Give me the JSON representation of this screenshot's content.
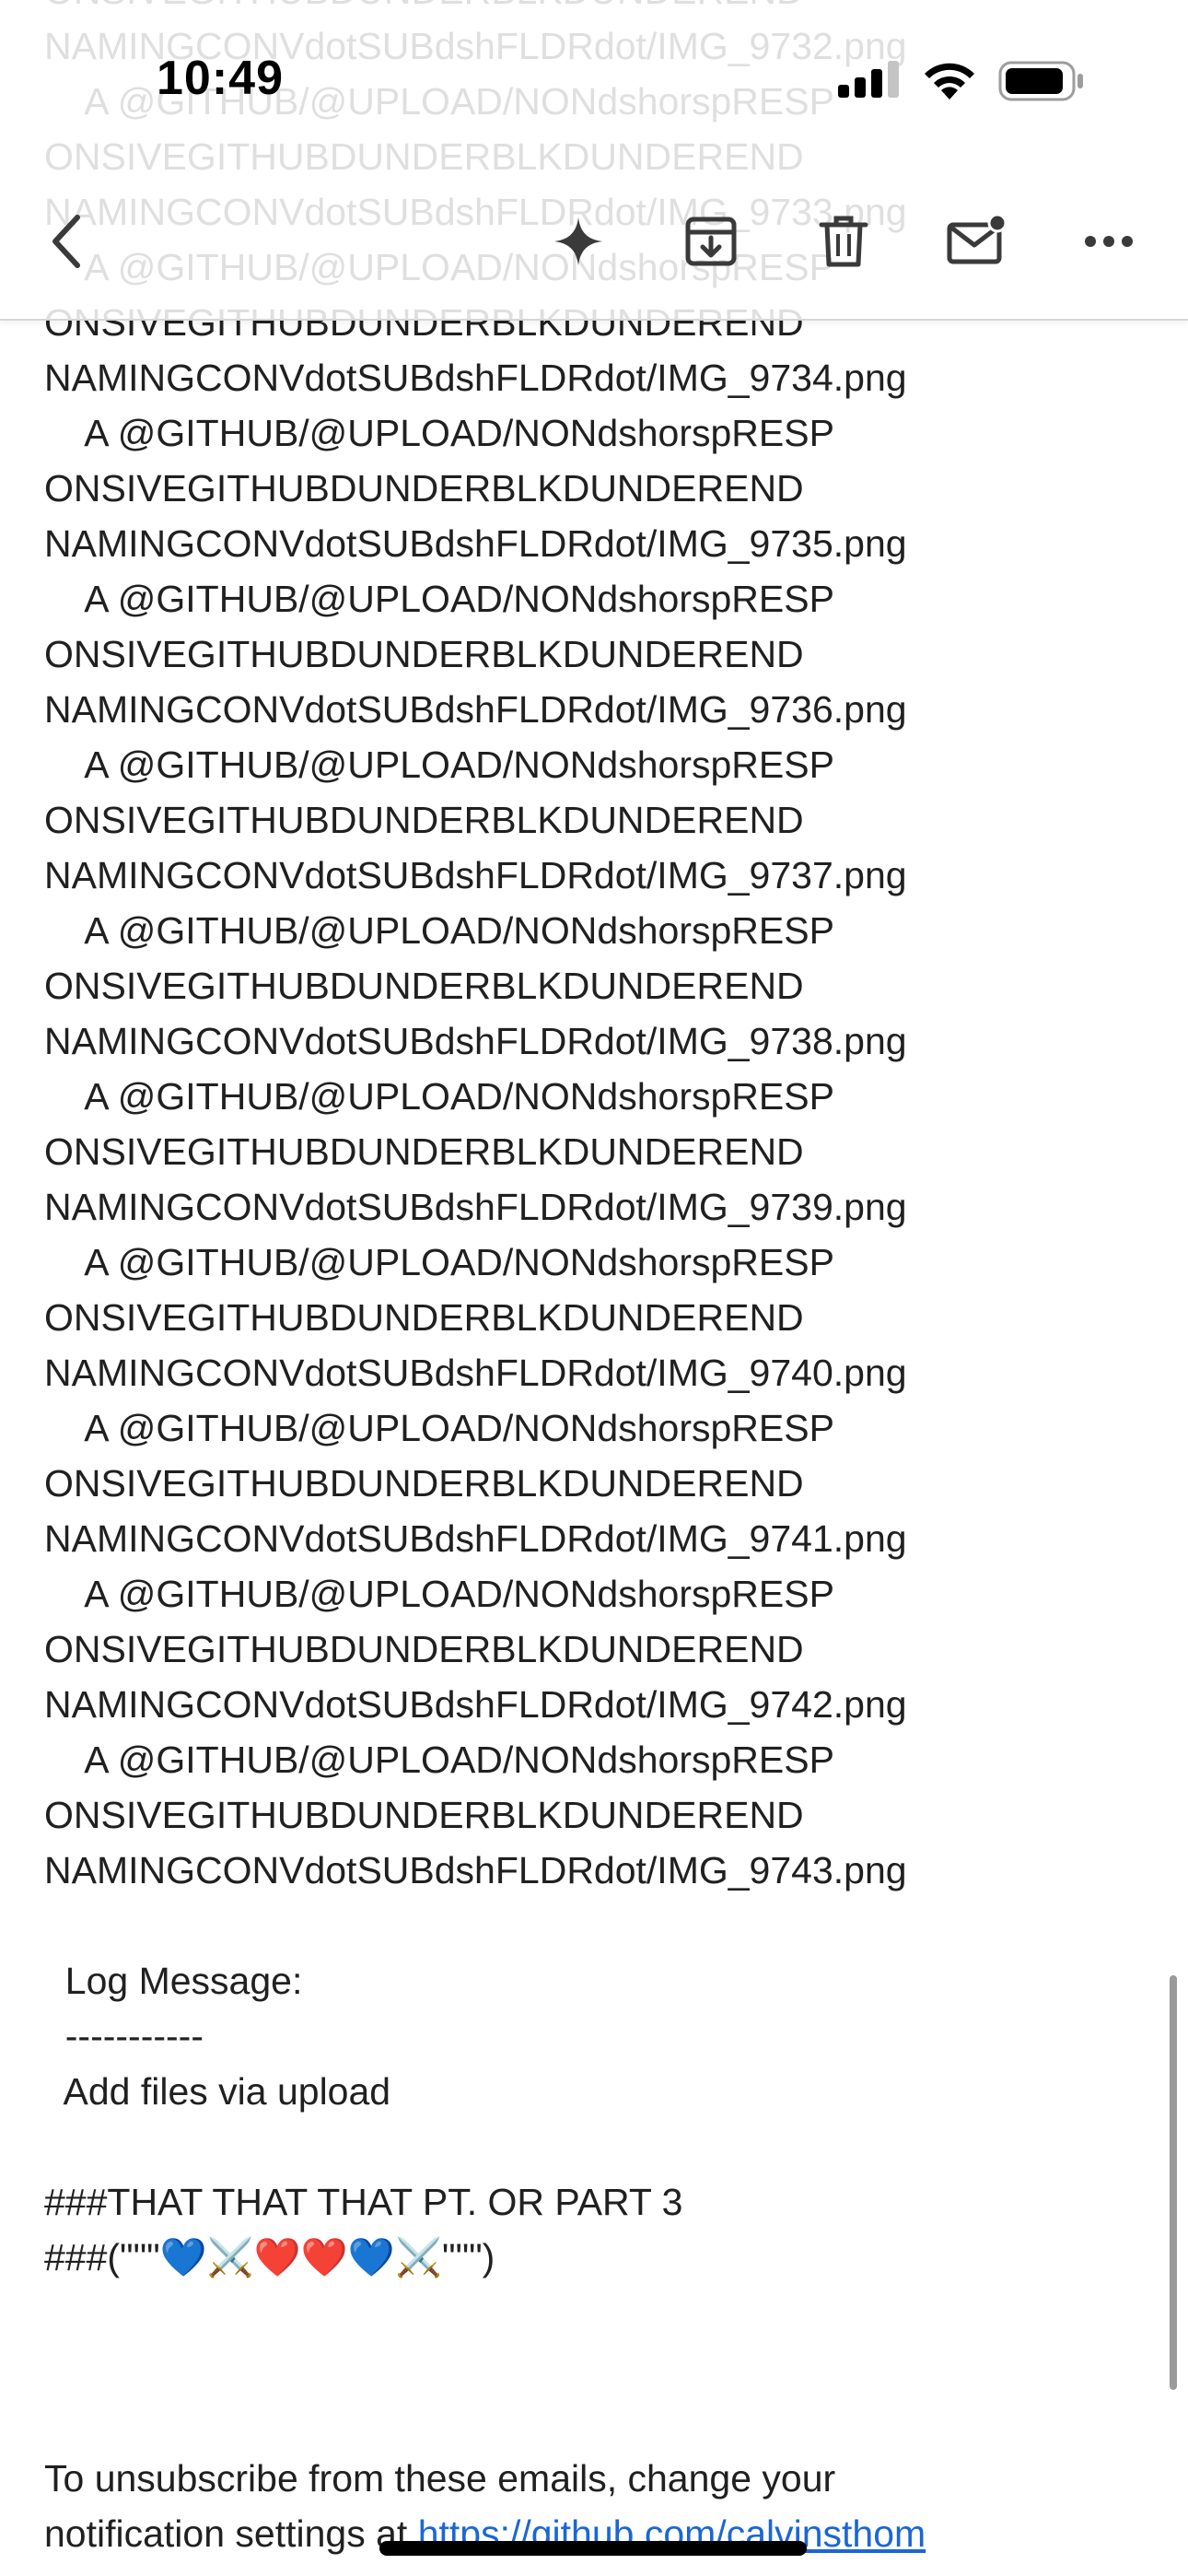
{
  "status_bar": {
    "time": "10:49"
  },
  "toolbar": {
    "back": "chevron-left-icon",
    "gemini": "sparkle-icon",
    "archive": "archive-icon",
    "delete": "trash-icon",
    "mark_unread": "mail-unread-icon",
    "more": "more-horizontal-icon"
  },
  "email": {
    "lines": [
      "ONSIVEGITHUBDUNDERBLKDUNDEREND",
      "NAMINGCONVdotSUBdshFLDRdot/IMG_9732.png",
      "    A @GITHUB/@UPLOAD/NONdshorspRESP",
      "ONSIVEGITHUBDUNDERBLKDUNDEREND",
      "NAMINGCONVdotSUBdshFLDRdot/IMG_9733.png",
      "    A @GITHUB/@UPLOAD/NONdshorspRESP",
      "ONSIVEGITHUBDUNDERBLKDUNDEREND",
      "NAMINGCONVdotSUBdshFLDRdot/IMG_9734.png",
      "    A @GITHUB/@UPLOAD/NONdshorspRESP",
      "ONSIVEGITHUBDUNDERBLKDUNDEREND",
      "NAMINGCONVdotSUBdshFLDRdot/IMG_9735.png",
      "    A @GITHUB/@UPLOAD/NONdshorspRESP",
      "ONSIVEGITHUBDUNDERBLKDUNDEREND",
      "NAMINGCONVdotSUBdshFLDRdot/IMG_9736.png",
      "    A @GITHUB/@UPLOAD/NONdshorspRESP",
      "ONSIVEGITHUBDUNDERBLKDUNDEREND",
      "NAMINGCONVdotSUBdshFLDRdot/IMG_9737.png",
      "    A @GITHUB/@UPLOAD/NONdshorspRESP",
      "ONSIVEGITHUBDUNDERBLKDUNDEREND",
      "NAMINGCONVdotSUBdshFLDRdot/IMG_9738.png",
      "    A @GITHUB/@UPLOAD/NONdshorspRESP",
      "ONSIVEGITHUBDUNDERBLKDUNDEREND",
      "NAMINGCONVdotSUBdshFLDRdot/IMG_9739.png",
      "    A @GITHUB/@UPLOAD/NONdshorspRESP",
      "ONSIVEGITHUBDUNDERBLKDUNDEREND",
      "NAMINGCONVdotSUBdshFLDRdot/IMG_9740.png",
      "    A @GITHUB/@UPLOAD/NONdshorspRESP",
      "ONSIVEGITHUBDUNDERBLKDUNDEREND",
      "NAMINGCONVdotSUBdshFLDRdot/IMG_9741.png",
      "    A @GITHUB/@UPLOAD/NONdshorspRESP",
      "ONSIVEGITHUBDUNDERBLKDUNDEREND",
      "NAMINGCONVdotSUBdshFLDRdot/IMG_9742.png",
      "    A @GITHUB/@UPLOAD/NONdshorspRESP",
      "ONSIVEGITHUBDUNDERBLKDUNDEREND",
      "NAMINGCONVdotSUBdshFLDRdot/IMG_9743.png"
    ],
    "log_label": "  Log Message:",
    "log_rule": "  -----------",
    "log_text": "  Add files via upload",
    "heading1": "###THAT THAT THAT PT. OR PART 3",
    "heading2": "###(\"\"\"💙⚔️❤️❤️💙⚔️\"\"\")",
    "footer_text": "To unsubscribe from these emails, change your",
    "footer_text2": "notification settings at ",
    "footer_link": "https://github.com/calvinsthom"
  }
}
